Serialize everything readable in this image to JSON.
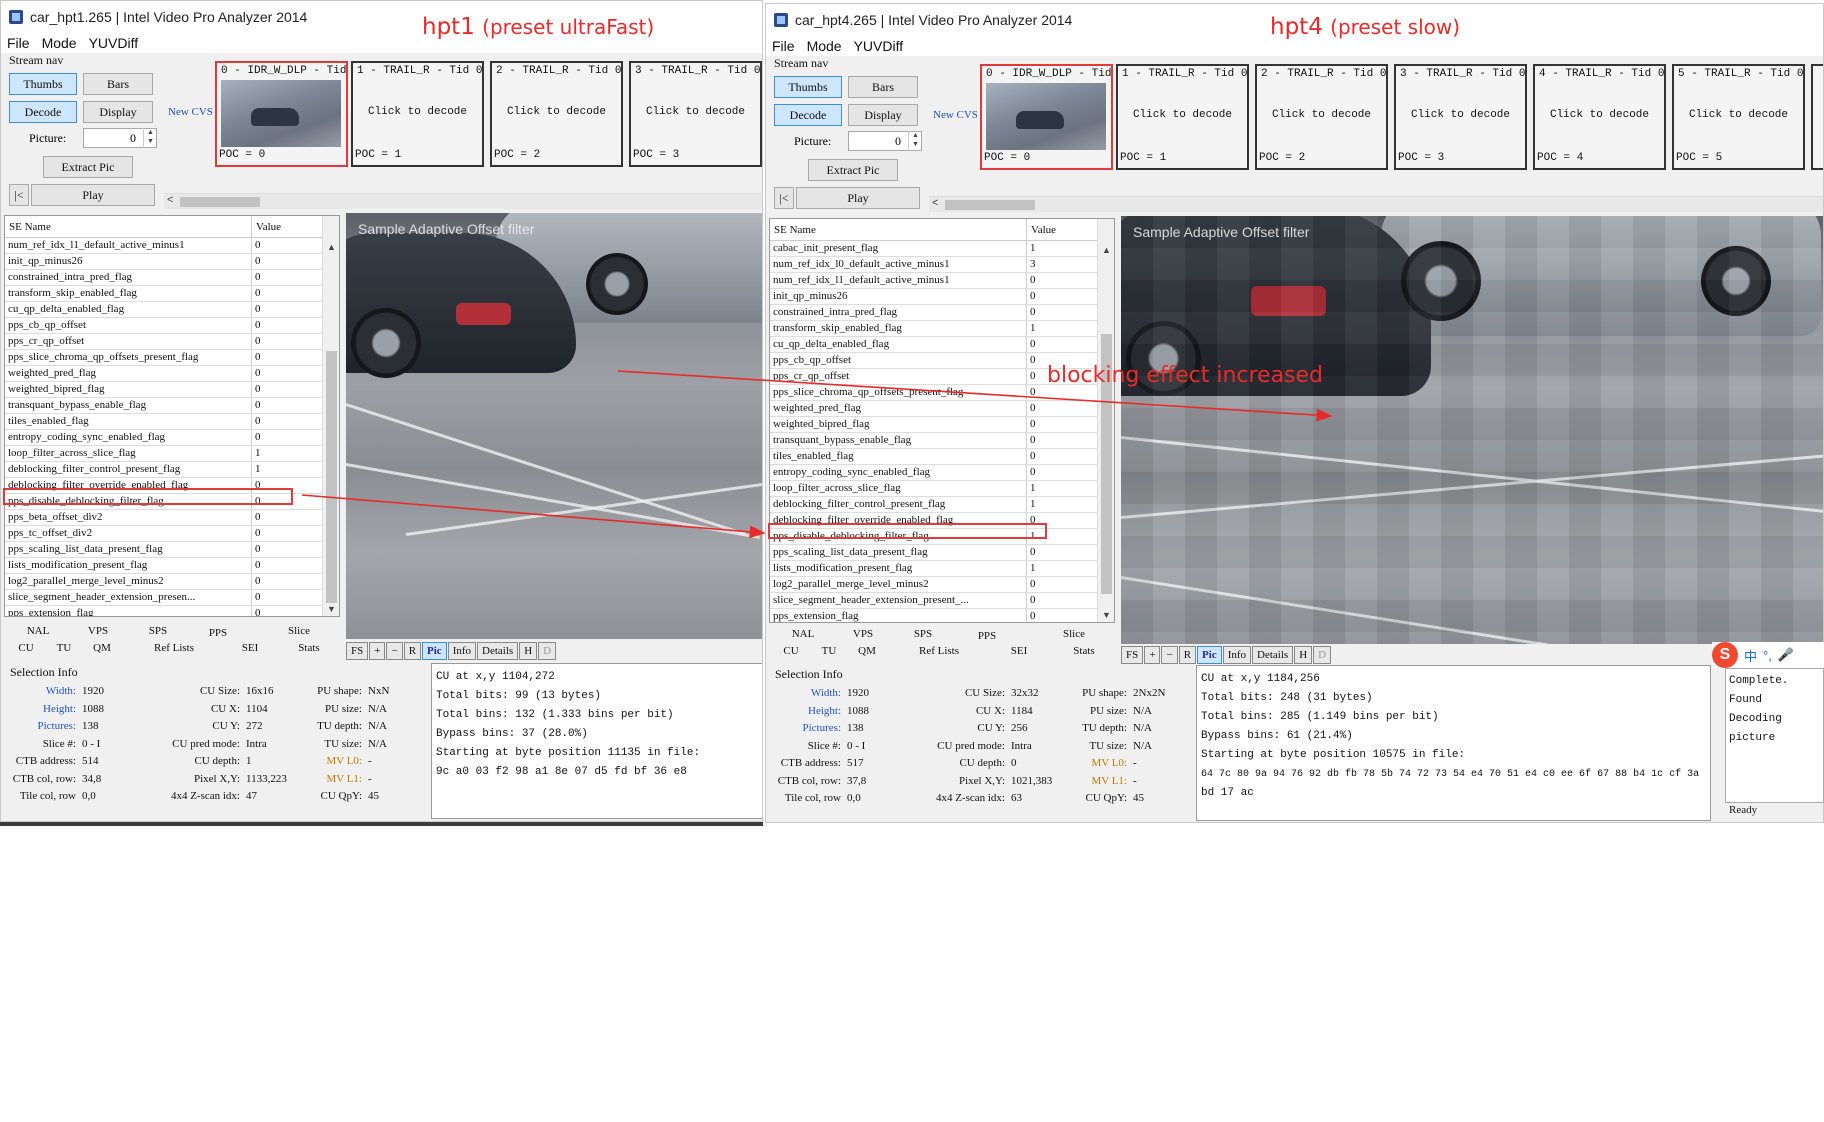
{
  "annotations": {
    "hpt1_label": "hpt1",
    "hpt1_preset": "(preset ultraFast)",
    "hpt4_label": "hpt4",
    "hpt4_preset": "(preset slow)",
    "blocking": "blocking effect increased",
    "color": "#e82a2a"
  },
  "w1": {
    "title": "car_hpt1.265 | Intel Video Pro Analyzer 2014",
    "menu": [
      "File",
      "Mode",
      "YUVDiff"
    ],
    "stream_nav": {
      "title": "Stream nav",
      "thumbs": "Thumbs",
      "bars": "Bars",
      "decode": "Decode",
      "display": "Display",
      "picture_label": "Picture:",
      "picture_value": "0",
      "extract": "Extract Pic",
      "first": "|<",
      "play": "Play"
    },
    "new_cvs": "New CVS",
    "thumbs": [
      {
        "header": "0 - IDR_W_DLP - Tid 0",
        "center": "",
        "poc": "POC = 0"
      },
      {
        "header": "1 - TRAIL_R - Tid 0",
        "center": "Click to decode",
        "poc": "POC = 1"
      },
      {
        "header": "2 - TRAIL_R - Tid 0",
        "center": "Click to decode",
        "poc": "POC = 2"
      },
      {
        "header": "3 - TRAIL_R - Tid 0",
        "center": "Click to decode",
        "poc": "POC = 3"
      }
    ],
    "table": {
      "col1": "SE Name",
      "col2": "Value",
      "rows": [
        [
          "num_ref_idx_l1_default_active_minus1",
          "0"
        ],
        [
          "init_qp_minus26",
          "0"
        ],
        [
          "constrained_intra_pred_flag",
          "0"
        ],
        [
          "transform_skip_enabled_flag",
          "0"
        ],
        [
          "cu_qp_delta_enabled_flag",
          "0"
        ],
        [
          "pps_cb_qp_offset",
          "0"
        ],
        [
          "pps_cr_qp_offset",
          "0"
        ],
        [
          "pps_slice_chroma_qp_offsets_present_flag",
          "0"
        ],
        [
          "weighted_pred_flag",
          "0"
        ],
        [
          "weighted_bipred_flag",
          "0"
        ],
        [
          "transquant_bypass_enable_flag",
          "0"
        ],
        [
          "tiles_enabled_flag",
          "0"
        ],
        [
          "entropy_coding_sync_enabled_flag",
          "0"
        ],
        [
          "loop_filter_across_slice_flag",
          "1"
        ],
        [
          "deblocking_filter_control_present_flag",
          "1"
        ],
        [
          "deblocking_filter_override_enabled_flag",
          "0"
        ],
        [
          "pps_disable_deblocking_filter_flag",
          "0"
        ],
        [
          "pps_beta_offset_div2",
          "0"
        ],
        [
          "pps_tc_offset_div2",
          "0"
        ],
        [
          "pps_scaling_list_data_present_flag",
          "0"
        ],
        [
          "lists_modification_present_flag",
          "0"
        ],
        [
          "log2_parallel_merge_level_minus2",
          "0"
        ],
        [
          "slice_segment_header_extension_presen...",
          "0"
        ],
        [
          "pps_extension_flag",
          "0"
        ]
      ]
    },
    "tabs_row1": [
      "NAL",
      "VPS",
      "SPS",
      "PPS",
      "Slice"
    ],
    "tabs_row2": [
      "CU",
      "TU",
      "QM",
      "Ref Lists",
      "SEI",
      "Stats"
    ],
    "photo_caption": "Sample Adaptive Offset filter",
    "toolbar": [
      "FS",
      "+",
      "−",
      "R",
      "Pic",
      "Info",
      "Details",
      "H",
      "D"
    ],
    "sel_title": "Selection Info",
    "sel": [
      [
        "Width:",
        "1920"
      ],
      [
        "CU Size:",
        "16x16"
      ],
      [
        "PU shape:",
        "NxN"
      ],
      [
        "Height:",
        "1088"
      ],
      [
        "CU X:",
        "1104"
      ],
      [
        "PU size:",
        "N/A"
      ],
      [
        "Pictures:",
        "138"
      ],
      [
        "CU Y:",
        "272"
      ],
      [
        "TU depth:",
        "N/A"
      ],
      [
        "Slice #:",
        "0 - I"
      ],
      [
        "CU pred mode:",
        "Intra"
      ],
      [
        "TU size:",
        "N/A"
      ],
      [
        "CTB address:",
        "514"
      ],
      [
        "CU depth:",
        "1"
      ],
      [
        "MV L0:",
        "-"
      ],
      [
        "CTB col, row:",
        "34,8"
      ],
      [
        "Pixel X,Y:",
        "1133,223"
      ],
      [
        "MV L1:",
        "-"
      ],
      [
        "Tile col, row",
        "0,0"
      ],
      [
        "4x4 Z-scan idx:",
        "47"
      ],
      [
        "CU QpY:",
        "45"
      ]
    ],
    "info": [
      "CU at x,y 1104,272",
      "Total bits: 99 (13 bytes)",
      "Total bins: 132 (1.333 bins per bit)",
      "Bypass bins: 37 (28.0%)",
      "Starting at byte position 11135 in file:",
      "9c a0 03 f2 98 a1 8e 07 d5 fd bf 36 e8"
    ]
  },
  "w2": {
    "title": "car_hpt4.265 | Intel Video Pro Analyzer 2014",
    "menu": [
      "File",
      "Mode",
      "YUVDiff"
    ],
    "stream_nav": {
      "title": "Stream nav",
      "thumbs": "Thumbs",
      "bars": "Bars",
      "decode": "Decode",
      "display": "Display",
      "picture_label": "Picture:",
      "picture_value": "0",
      "extract": "Extract Pic",
      "first": "|<",
      "play": "Play"
    },
    "new_cvs": "New CVS",
    "thumbs": [
      {
        "header": "0 - IDR_W_DLP - Tid 0",
        "center": "",
        "poc": "POC = 0"
      },
      {
        "header": "1 - TRAIL_R - Tid 0",
        "center": "Click to decode",
        "poc": "POC = 1"
      },
      {
        "header": "2 - TRAIL_R - Tid 0",
        "center": "Click to decode",
        "poc": "POC = 2"
      },
      {
        "header": "3 - TRAIL_R - Tid 0",
        "center": "Click to decode",
        "poc": "POC = 3"
      },
      {
        "header": "4 - TRAIL_R - Tid 0",
        "center": "Click to decode",
        "poc": "POC = 4"
      },
      {
        "header": "5 - TRAIL_R - Tid 0",
        "center": "Click to decode",
        "poc": "POC = 5"
      }
    ],
    "table": {
      "col1": "SE Name",
      "col2": "Value",
      "rows": [
        [
          "cabac_init_present_flag",
          "1"
        ],
        [
          "num_ref_idx_l0_default_active_minus1",
          "3"
        ],
        [
          "num_ref_idx_l1_default_active_minus1",
          "0"
        ],
        [
          "init_qp_minus26",
          "0"
        ],
        [
          "constrained_intra_pred_flag",
          "0"
        ],
        [
          "transform_skip_enabled_flag",
          "1"
        ],
        [
          "cu_qp_delta_enabled_flag",
          "0"
        ],
        [
          "pps_cb_qp_offset",
          "0"
        ],
        [
          "pps_cr_qp_offset",
          "0"
        ],
        [
          "pps_slice_chroma_qp_offsets_present_flag",
          "0"
        ],
        [
          "weighted_pred_flag",
          "0"
        ],
        [
          "weighted_bipred_flag",
          "0"
        ],
        [
          "transquant_bypass_enable_flag",
          "0"
        ],
        [
          "tiles_enabled_flag",
          "0"
        ],
        [
          "entropy_coding_sync_enabled_flag",
          "0"
        ],
        [
          "loop_filter_across_slice_flag",
          "1"
        ],
        [
          "deblocking_filter_control_present_flag",
          "1"
        ],
        [
          "deblocking_filter_override_enabled_flag",
          "0"
        ],
        [
          "pps_disable_deblocking_filter_flag",
          "1"
        ],
        [
          "pps_scaling_list_data_present_flag",
          "0"
        ],
        [
          "lists_modification_present_flag",
          "1"
        ],
        [
          "log2_parallel_merge_level_minus2",
          "0"
        ],
        [
          "slice_segment_header_extension_present_...",
          "0"
        ],
        [
          "pps_extension_flag",
          "0"
        ]
      ]
    },
    "tabs_row1": [
      "NAL",
      "VPS",
      "SPS",
      "PPS",
      "Slice"
    ],
    "tabs_row2": [
      "CU",
      "TU",
      "QM",
      "Ref Lists",
      "SEI",
      "Stats"
    ],
    "photo_caption": "Sample Adaptive Offset filter",
    "toolbar": [
      "FS",
      "+",
      "−",
      "R",
      "Pic",
      "Info",
      "Details",
      "H",
      "D"
    ],
    "sel_title": "Selection Info",
    "sel": [
      [
        "Width:",
        "1920"
      ],
      [
        "CU Size:",
        "32x32"
      ],
      [
        "PU shape:",
        "2Nx2N"
      ],
      [
        "Height:",
        "1088"
      ],
      [
        "CU X:",
        "1184"
      ],
      [
        "PU size:",
        "N/A"
      ],
      [
        "Pictures:",
        "138"
      ],
      [
        "CU Y:",
        "256"
      ],
      [
        "TU depth:",
        "N/A"
      ],
      [
        "Slice #:",
        "0 - I"
      ],
      [
        "CU pred mode:",
        "Intra"
      ],
      [
        "TU size:",
        "N/A"
      ],
      [
        "CTB address:",
        "517"
      ],
      [
        "CU depth:",
        "0"
      ],
      [
        "MV L0:",
        "-"
      ],
      [
        "CTB col, row:",
        "37,8"
      ],
      [
        "Pixel X,Y:",
        "1021,383"
      ],
      [
        "MV L1:",
        "-"
      ],
      [
        "Tile col, row",
        "0,0"
      ],
      [
        "4x4 Z-scan idx:",
        "63"
      ],
      [
        "CU QpY:",
        "45"
      ]
    ],
    "info": [
      "CU at x,y 1184,256",
      "Total bits: 248 (31 bytes)",
      "Total bins: 285 (1.149 bins per bit)",
      "Bypass bins: 61 (21.4%)",
      "Starting at byte position 10575 in file:",
      "64 7c 80 9a 94 76 92 db fb 78 5b 74 72 73 54 e4 70 51 e4 c0 ee 6f 67 88 b4 1c cf 3a",
      "bd 17 ac"
    ],
    "status": [
      "Complete. Found",
      "Decoding picture"
    ],
    "ready": "Ready",
    "ime": [
      "S",
      "中",
      "°,",
      "🎤"
    ]
  }
}
